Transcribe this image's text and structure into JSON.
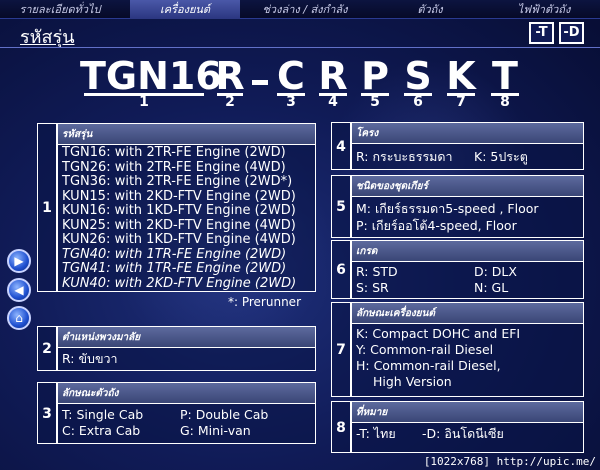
{
  "nav": {
    "tabs": [
      "รายละเอียดทั่วไป",
      "เครื่องยนต์",
      "ช่วงล่าง / ส่งกำลัง",
      "ตัวถัง",
      "ไฟฟ้าตัวถัง"
    ],
    "active_index": 1
  },
  "header": {
    "title": "รหัสรุ่น",
    "lang_t": "-T",
    "lang_d": "-D"
  },
  "code": {
    "letters": [
      "TGN16",
      "R",
      "C",
      "R",
      "P",
      "S",
      "K",
      "T"
    ],
    "numbers": [
      "1",
      "2",
      "3",
      "4",
      "5",
      "6",
      "7",
      "8"
    ]
  },
  "side_buttons": [
    "next-icon",
    "back-icon",
    "home-icon"
  ],
  "sections": {
    "s1": {
      "num": "1",
      "head": "รหัสรุ่น",
      "models": [
        "TGN16: with 2TR-FE Engine (2WD)",
        "TGN26: with 2TR-FE Engine (4WD)",
        "TGN36: with 2TR-FE Engine (2WD*)",
        "KUN15: with 2KD-FTV Engine (2WD)",
        "KUN16: with 1KD-FTV Engine (2WD)",
        "KUN25: with 2KD-FTV Engine (4WD)",
        "KUN26: with 1KD-FTV Engine (4WD)",
        "TGN40: with 1TR-FE Engine (2WD)",
        "TGN41: with 1TR-FE Engine (2WD)",
        "KUN40: with 2KD-FTV Engine (2WD)"
      ],
      "italic_from": 7,
      "note": "*: Prerunner"
    },
    "s2": {
      "num": "2",
      "head": "ตำแหน่งพวงมาลัย",
      "line": "R: ขับขวา"
    },
    "s3": {
      "num": "3",
      "head": "ลักษณะตัวถัง",
      "a1": "T: Single Cab",
      "a2": "P: Double Cab",
      "b1": "C: Extra Cab",
      "b2": "G: Mini-van"
    },
    "s4": {
      "num": "4",
      "head": "โครง",
      "a": "R: กระบะธรรมดา",
      "b": "K: 5ประตู"
    },
    "s5": {
      "num": "5",
      "head": "ชนิดของชุดเกียร์",
      "l1": "M: เกียร์ธรรมดา5-speed , Floor",
      "l2": "P: เกียร์ออโต้4-speed, Floor"
    },
    "s6": {
      "num": "6",
      "head": "เกรด",
      "a1": "R: STD",
      "a2": "D: DLX",
      "b1": "S: SR",
      "b2": "N: GL"
    },
    "s7": {
      "num": "7",
      "head": "ลักษณะเครื่องยนต์",
      "l1": "K: Compact DOHC and EFI",
      "l2": "Y: Common-rail Diesel",
      "l3": "H: Common-rail Diesel,",
      "l4": "High Version"
    },
    "s8": {
      "num": "8",
      "head": "ที่หมาย",
      "a": "-T: ไทย",
      "b": "-D: อินโดนีเซีย"
    }
  },
  "footer": {
    "url": "[1022x768] http://upic.me/"
  }
}
